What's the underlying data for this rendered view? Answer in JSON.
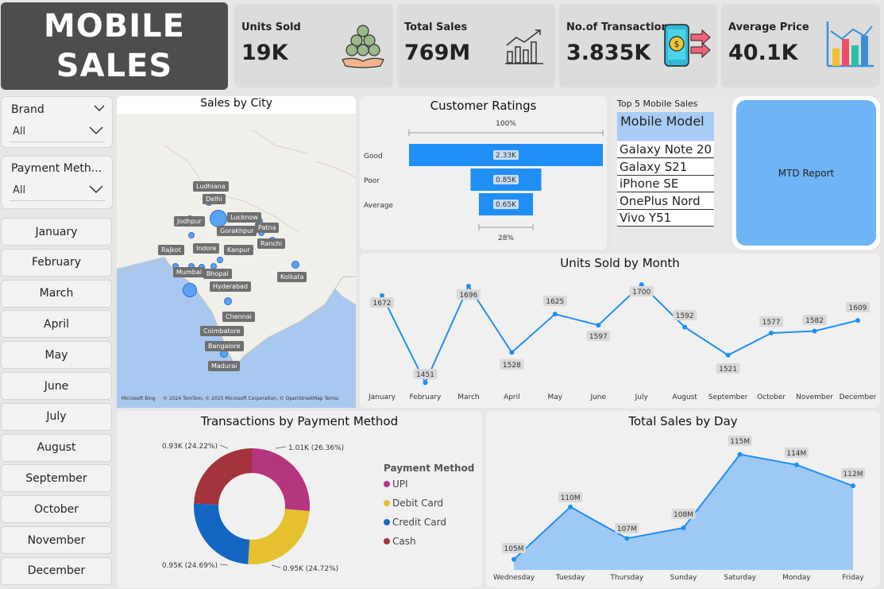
{
  "title": {
    "line1": "MOBILE",
    "line2": "SALES"
  },
  "kpis": [
    {
      "label": "Units Sold",
      "value": "19K",
      "icon": "coins-hand-icon"
    },
    {
      "label": "Total Sales",
      "value": "769M",
      "icon": "growth-chart-icon"
    },
    {
      "label": "No.of Transactions",
      "value": "3.835K",
      "icon": "mobile-payment-icon"
    },
    {
      "label": "Average Price",
      "value": "40.1K",
      "icon": "bar-chart-icon"
    }
  ],
  "slicers": {
    "brand": {
      "label": "Brand",
      "value": "All"
    },
    "payment": {
      "label": "Payment Meth...",
      "value": "All"
    }
  },
  "months": [
    "January",
    "February",
    "March",
    "April",
    "May",
    "June",
    "July",
    "August",
    "September",
    "October",
    "November",
    "December"
  ],
  "map": {
    "title": "Sales by City",
    "cities": [
      "Ludhiana",
      "Delhi",
      "Jodhpur",
      "Lucknow",
      "Gorakhpur",
      "Patna",
      "Rajkot",
      "Indore",
      "Kanpur",
      "Ranchi",
      "Mumbai",
      "Bhopal",
      "Kolkata",
      "Hyderabad",
      "Chennai",
      "Coimbatore",
      "Bangalore",
      "Madurai"
    ],
    "footer": "© 2024 TomTom, © 2025 Microsoft Corporation, © OpenStreetMap  Terms",
    "brand": "Microsoft Bing"
  },
  "ratings": {
    "title": "Customer Ratings",
    "top_pct": "100%",
    "bottom_pct": "28%",
    "rows": [
      {
        "label": "Good",
        "value": 2.33,
        "text": "2.33K"
      },
      {
        "label": "Poor",
        "value": 0.85,
        "text": "0.85K"
      },
      {
        "label": "Average",
        "value": 0.65,
        "text": "0.65K"
      }
    ]
  },
  "top5": {
    "title": "Top 5 Mobile Sales",
    "header": "Mobile Model",
    "items": [
      "Galaxy Note 20",
      "Galaxy S21",
      "iPhone SE",
      "OnePlus Nord",
      "Vivo Y51"
    ]
  },
  "mtd": {
    "label": "MTD Report"
  },
  "chart_data": [
    {
      "type": "line",
      "title": "Units Sold by Month",
      "categories": [
        "January",
        "February",
        "March",
        "April",
        "May",
        "June",
        "July",
        "August",
        "September",
        "October",
        "November",
        "December"
      ],
      "values": [
        1672,
        1451,
        1696,
        1528,
        1625,
        1597,
        1700,
        1592,
        1521,
        1577,
        1582,
        1609
      ],
      "color": "#1f8ff5"
    },
    {
      "type": "pie",
      "title": "Transactions by Payment Method",
      "legend_title": "Payment Method",
      "categories": [
        "UPI",
        "Debit Card",
        "Credit Card",
        "Cash"
      ],
      "values": [
        1.01,
        0.95,
        0.95,
        0.93
      ],
      "labels": [
        "1.01K (26.36%)",
        "0.95K (24.72%)",
        "0.95K (24.69%)",
        "0.93K (24.22%)"
      ],
      "colors": [
        "#b5357f",
        "#e5c12f",
        "#1367c2",
        "#a3333d"
      ]
    },
    {
      "type": "area",
      "title": "Total Sales by Day",
      "categories": [
        "Wednesday",
        "Tuesday",
        "Thursday",
        "Sunday",
        "Saturday",
        "Monday",
        "Friday"
      ],
      "values": [
        105,
        110,
        107,
        108,
        115,
        114,
        112
      ],
      "labels": [
        "105M",
        "110M",
        "107M",
        "108M",
        "115M",
        "114M",
        "112M"
      ],
      "color": "#1f8ff5",
      "fill": "#9ec9f5"
    }
  ]
}
